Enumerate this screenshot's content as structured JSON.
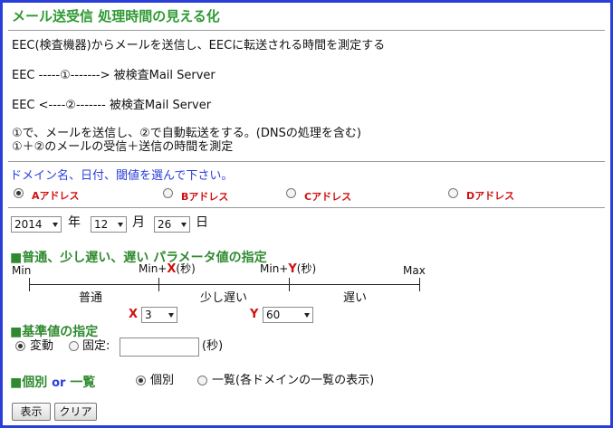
{
  "title": "メール送受信 処理時間の見える化",
  "intro": {
    "line1": "EEC(検査機器)からメールを送信し、EECに転送される時間を測定する",
    "line2": "EEC -----①-------> 被検査Mail Server",
    "line3": "EEC <----②-------  被検査Mail Server",
    "line4": "①で、メールを送信し、②で自動転送をする。(DNSの処理を含む)",
    "line5": "①＋②のメールの受信＋送信の時間を測定"
  },
  "domain_prompt": "ドメイン名、日付、閾値を選んで下さい。",
  "domains": [
    {
      "label": "Aアドレス",
      "checked": true
    },
    {
      "label": "Bアドレス",
      "checked": false
    },
    {
      "label": "Cアドレス",
      "checked": false
    },
    {
      "label": "Dアドレス",
      "checked": false
    }
  ],
  "date": {
    "year": "2014",
    "year_label": "年",
    "month": "12",
    "month_label": "月",
    "day": "26",
    "day_label": "日"
  },
  "params": {
    "heading": "■普通、少し遅い、遅い パラメータ値の指定",
    "min": "Min",
    "minx_prefix": "Min+",
    "x": "X",
    "x_suffix": "(秒)",
    "miny_prefix": "Min+",
    "y": "Y",
    "y_suffix": "(秒)",
    "max": "Max",
    "normal": "普通",
    "slightly_slow": "少し遅い",
    "slow": "遅い",
    "x_label": "X",
    "x_value": "3",
    "y_label": "Y",
    "y_value": "60"
  },
  "baseline": {
    "heading": "■基準値の指定",
    "variable": "変動",
    "variable_checked": true,
    "fixed": "固定:",
    "fixed_checked": false,
    "fixed_value": "",
    "unit": "(秒)"
  },
  "view": {
    "heading": "■個別",
    "or": "or",
    "heading2": "一覧",
    "individual": "個別",
    "individual_checked": true,
    "list": "一覧(各ドメインの一覧の表示)",
    "list_checked": false
  },
  "buttons": {
    "display": "表示",
    "clear": "クリア"
  },
  "colors": {
    "frame": "#2a3fd9",
    "heading": "#2f9a33",
    "accent_red": "#d01010",
    "prompt_blue": "#2a3fd9"
  }
}
